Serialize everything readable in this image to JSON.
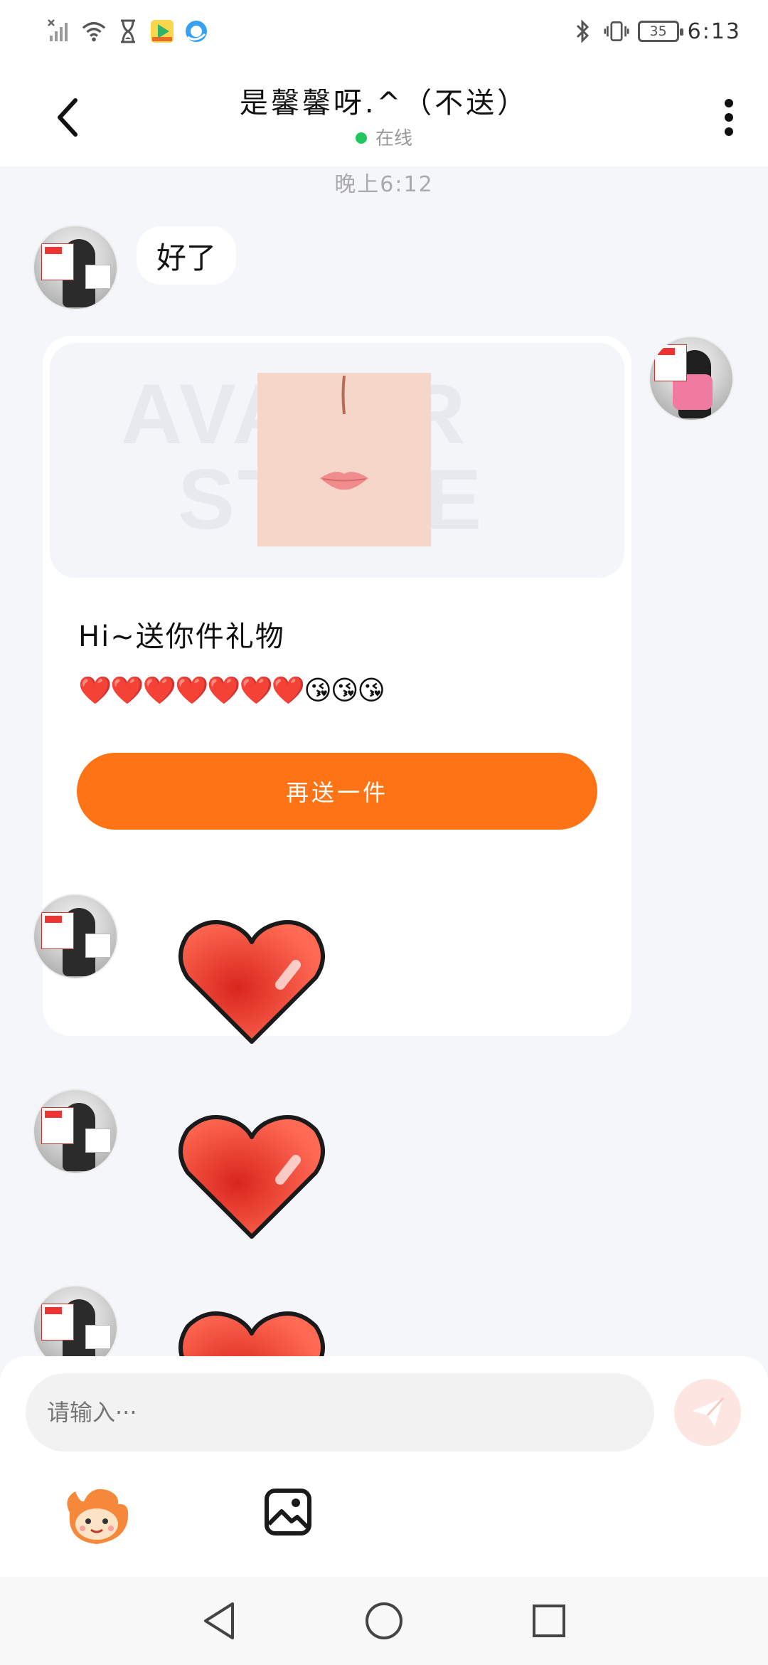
{
  "status_bar": {
    "time": "6:13",
    "battery": "35",
    "left_icons": [
      "signal-off-icon",
      "wifi-icon",
      "hourglass-icon",
      "video-app-icon",
      "browser-app-icon"
    ],
    "right_icons": [
      "bluetooth-icon",
      "vibrate-icon",
      "battery-icon"
    ]
  },
  "header": {
    "title": "是馨馨呀.^（不送）",
    "status": "在线",
    "status_color": "#22c55e"
  },
  "chat": {
    "timestamp": "晚上6:12",
    "messages": [
      {
        "side": "left",
        "type": "text",
        "text": "好了"
      },
      {
        "side": "right",
        "type": "gift",
        "watermark_line1": "AVATAR",
        "watermark_line2": "STORE",
        "gift_title": "Hi~送你件礼物",
        "gift_message": "❤️❤️❤️❤️❤️❤️❤️😘😘😘",
        "button_label": "再送一件"
      },
      {
        "side": "left",
        "type": "sticker",
        "sticker": "red-heart"
      },
      {
        "side": "left",
        "type": "sticker",
        "sticker": "red-heart"
      },
      {
        "side": "left",
        "type": "sticker",
        "sticker": "red-heart"
      }
    ]
  },
  "composer": {
    "placeholder": "请输入···",
    "send_icon": "paper-plane-icon",
    "tools": [
      "mascot-emoji-icon",
      "image-icon"
    ]
  },
  "colors": {
    "accent": "#fe7316",
    "background": "#f4f6fa"
  },
  "nav": [
    "back-triangle",
    "home-circle",
    "recents-square"
  ]
}
